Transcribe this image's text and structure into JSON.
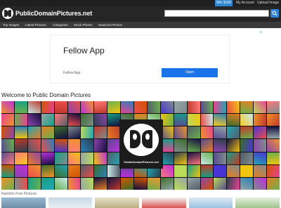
{
  "topbar": {
    "win_label": "Win $100",
    "account_label": "My Account",
    "upload_label": "Upload Image"
  },
  "header": {
    "logo_text": "PublicDomainPictures.net",
    "search_placeholder": ""
  },
  "nav": {
    "items": [
      "Top Images",
      "Latest Pictures",
      "Categories",
      "Stock Photos",
      "Seasonal Photos"
    ]
  },
  "ad": {
    "choices_label": "▷",
    "title": "Fellow App",
    "subtitle": "Fellow App",
    "button_label": "Open"
  },
  "main": {
    "welcome_title": "Welcome to Public Domain Pictures",
    "mosaic_caption": "PublicDomainPictures.net",
    "random_label": "Random Free Pictures"
  },
  "colors": {
    "accent": "#2f86d4",
    "header_bg": "#262626",
    "nav_bg": "#3a3a3a"
  }
}
